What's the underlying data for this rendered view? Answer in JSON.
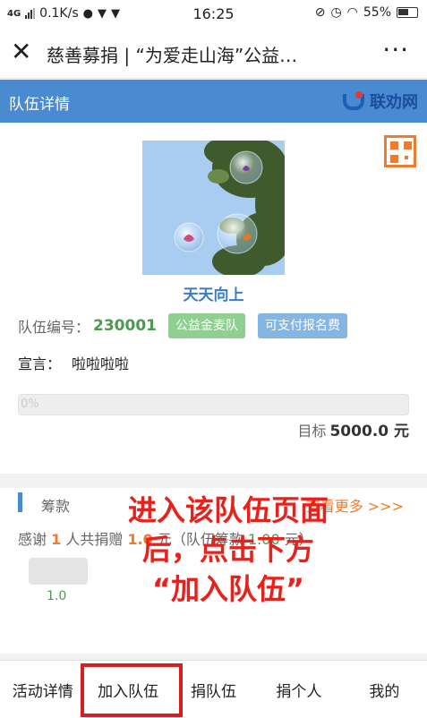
{
  "status_bar": {
    "network": "4G",
    "speed": "0.1K/s",
    "time": "16:25",
    "battery": "55%",
    "icons": [
      "wechat-icon",
      "shield-icon",
      "shield-icon",
      "mute-icon",
      "alarm-icon",
      "wifi-icon",
      "battery-icon"
    ]
  },
  "nav": {
    "close_glyph": "✕",
    "title": "慈善募捐 | “为爱走山海”公益…",
    "more_glyph": "···"
  },
  "team_header": {
    "title": "队伍详情",
    "brand": "联劝网"
  },
  "team": {
    "name": "天天向上",
    "id_label": "队伍编号：",
    "id": "230001",
    "badge_1": "公益金麦队",
    "badge_2": "可支付报名费",
    "slogan_label": "宣言：",
    "slogan": "啦啦啦啦",
    "progress": 0.0,
    "progress_text": "0%",
    "target_label": "目标",
    "target": "5000.0 元"
  },
  "donate": {
    "title": "筹款",
    "more": "查看更多 >>>",
    "thanks_prefix": "感谢",
    "count": "1",
    "thanks_mid": "人共捐赠",
    "amount": "1.0",
    "thanks_unit": "元（队伍筹款",
    "team_amount": "1.00",
    "thanks_end": "元）",
    "donor_amount": "1.0"
  },
  "annotation": {
    "line1": "进入该队伍页面",
    "line2": "后，点击下方",
    "line3": "“加入队伍”"
  },
  "tabs": [
    {
      "label": "活动详情"
    },
    {
      "label": "加入队伍"
    },
    {
      "label": "捐队伍"
    },
    {
      "label": "捐个人"
    },
    {
      "label": "我的"
    }
  ],
  "colors": {
    "header_blue": "#4a8ad0",
    "accent_orange": "#f07b2c",
    "green": "#4a9a50",
    "annotation_red": "#e8211c"
  }
}
